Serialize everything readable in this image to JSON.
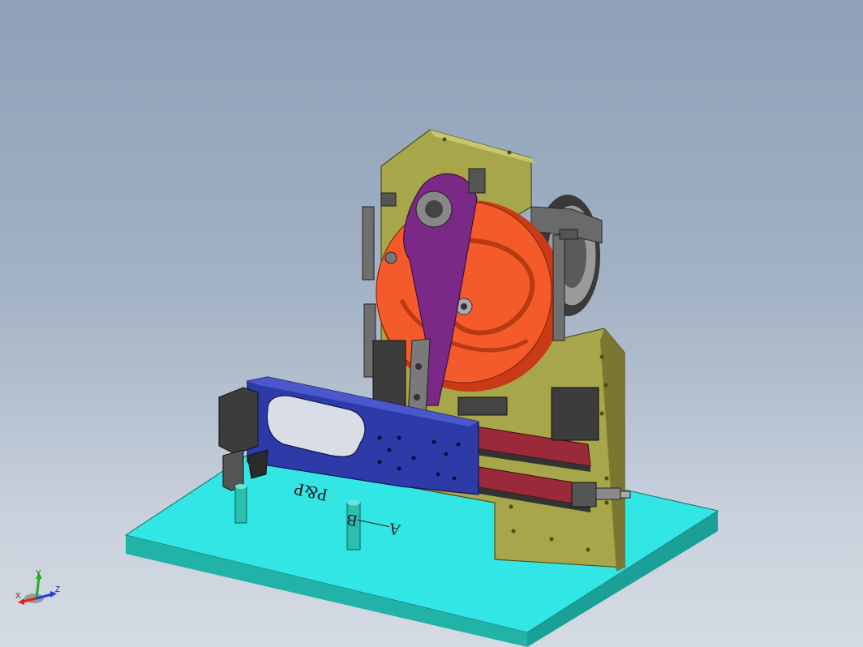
{
  "scene": {
    "engraving_top": "P&P",
    "engraving_bottom": "A——B",
    "colors": {
      "background_top": "#8fa0b7",
      "background_bottom": "#d5dbe3",
      "base_plate": "#33e6e6",
      "frame": "#a8a64a",
      "cam": "#f45a2a",
      "lever_arm": "#7a2a86",
      "slider": "#2d3aa8",
      "rail": "#9a2a3a",
      "rod": "#2bbfb0",
      "steel": "#8a8a8a"
    }
  },
  "axis_triad": {
    "x_label": "X",
    "y_label": "Y",
    "z_label": "Z",
    "x_color": "#e02020",
    "y_color": "#20b020",
    "z_color": "#2040e0"
  }
}
